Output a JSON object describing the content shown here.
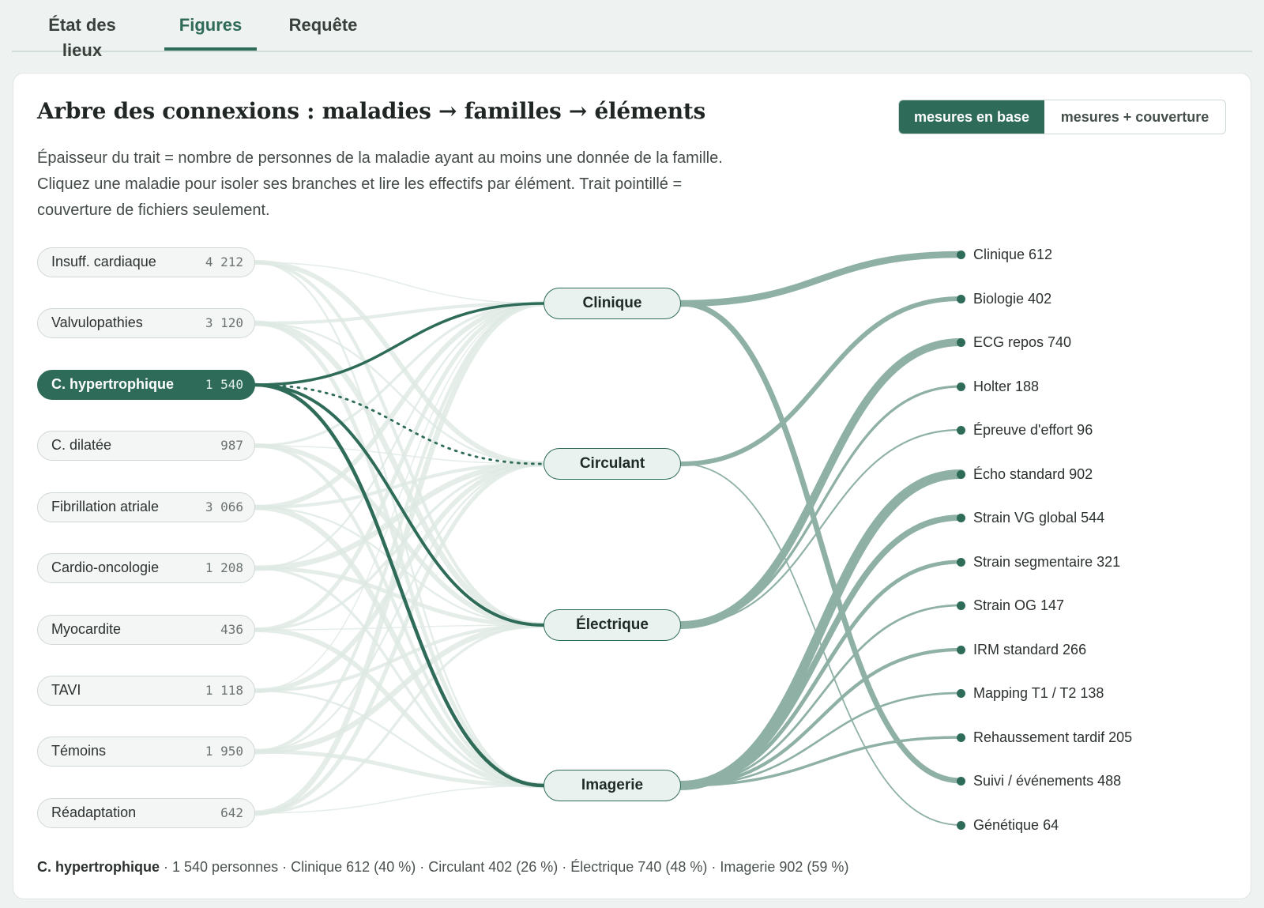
{
  "tabs": [
    {
      "label": "État des lieux"
    },
    {
      "label": "Figures"
    },
    {
      "label": "Requête"
    }
  ],
  "active_tab": "Figures",
  "title": "Arbre des connexions : maladies → familles → éléments",
  "toggle": {
    "options": [
      {
        "label": "mesures en base"
      },
      {
        "label": "mesures + couverture"
      }
    ],
    "active": "mesures en base"
  },
  "description": "Épaisseur du trait = nombre de personnes de la maladie ayant au moins une donnée de la famille. Cliquez une maladie pour isoler ses branches et lire les effectifs par élément. Trait pointillé = couverture de fichiers seulement.",
  "diseases": [
    {
      "label": "Insuff. cardiaque",
      "count": "4 212"
    },
    {
      "label": "Valvulopathies",
      "count": "3 120"
    },
    {
      "label": "C. hypertrophique",
      "count": "1 540"
    },
    {
      "label": "C. dilatée",
      "count": "987"
    },
    {
      "label": "Fibrillation atriale",
      "count": "3 066"
    },
    {
      "label": "Cardio-oncologie",
      "count": "1 208"
    },
    {
      "label": "Myocardite",
      "count": "436"
    },
    {
      "label": "TAVI",
      "count": "1 118"
    },
    {
      "label": "Témoins",
      "count": "1 950"
    },
    {
      "label": "Réadaptation",
      "count": "642"
    }
  ],
  "selected_disease": "C. hypertrophique",
  "families": [
    {
      "label": "Clinique"
    },
    {
      "label": "Circulant"
    },
    {
      "label": "Électrique"
    },
    {
      "label": "Imagerie"
    }
  ],
  "elements": [
    {
      "label": "Clinique 612",
      "value": 612,
      "family": "Clinique"
    },
    {
      "label": "Biologie 402",
      "value": 402,
      "family": "Circulant"
    },
    {
      "label": "ECG repos 740",
      "value": 740,
      "family": "Électrique"
    },
    {
      "label": "Holter 188",
      "value": 188,
      "family": "Électrique"
    },
    {
      "label": "Épreuve d'effort 96",
      "value": 96,
      "family": "Électrique"
    },
    {
      "label": "Écho standard 902",
      "value": 902,
      "family": "Imagerie"
    },
    {
      "label": "Strain VG global 544",
      "value": 544,
      "family": "Imagerie"
    },
    {
      "label": "Strain segmentaire 321",
      "value": 321,
      "family": "Imagerie"
    },
    {
      "label": "Strain OG 147",
      "value": 147,
      "family": "Imagerie"
    },
    {
      "label": "IRM standard 266",
      "value": 266,
      "family": "Imagerie"
    },
    {
      "label": "Mapping T1 / T2 138",
      "value": 138,
      "family": "Imagerie"
    },
    {
      "label": "Rehaussement tardif 205",
      "value": 205,
      "family": "Imagerie"
    },
    {
      "label": "Suivi / événements 488",
      "value": 488,
      "family": "Clinique"
    },
    {
      "label": "Génétique 64",
      "value": 64,
      "family": "Circulant"
    }
  ],
  "selected_links": [
    {
      "family": "Clinique",
      "value": 612,
      "dashed": false
    },
    {
      "family": "Circulant",
      "value": 402,
      "dashed": true
    },
    {
      "family": "Électrique",
      "value": 740,
      "dashed": false
    },
    {
      "family": "Imagerie",
      "value": 902,
      "dashed": false
    }
  ],
  "footer": {
    "name": "C. hypertrophique",
    "detail": " · 1 540 personnes · Clinique 612 (40 %) · Circulant 402 (26 %) · Électrique 740 (48 %) · Imagerie 902 (59 %)"
  },
  "colors": {
    "accent": "#2f6b59",
    "link_family_element": "#8fb1a5",
    "link_faint": "#dfe8e4"
  }
}
